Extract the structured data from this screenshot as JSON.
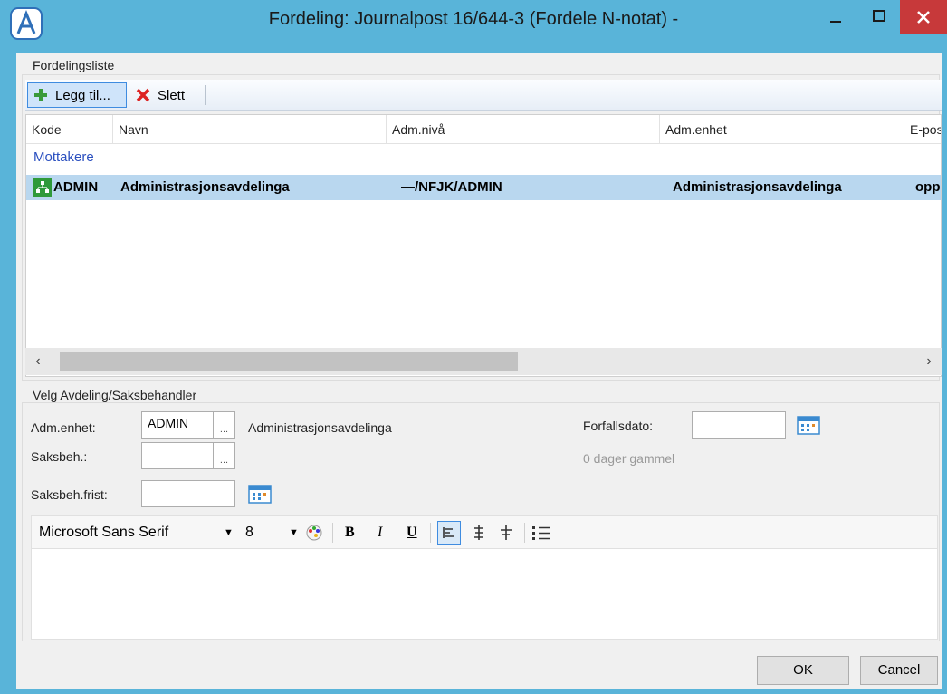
{
  "window": {
    "title": "Fordeling: Journalpost 16/644-3 (Fordele N-notat) -",
    "icon": "a-logo-icon",
    "controls": [
      "minimize-icon",
      "maximize-icon",
      "close-icon"
    ],
    "colors": {
      "titlebar": "#59b4d9",
      "close": "#c7393a",
      "selection": "#b9d7ef",
      "group_link": "#2a4fbf"
    }
  },
  "distribution": {
    "group_title": "Fordelingsliste",
    "toolbar": {
      "add_label": "Legg til...",
      "delete_label": "Slett"
    },
    "columns": [
      "Kode",
      "Navn",
      "Adm.nivå",
      "Adm.enhet",
      "E-pos"
    ],
    "group_label": "Mottakere",
    "rows": [
      {
        "code": "ADMIN",
        "name": "Administrasjonsavdelinga",
        "level": "—/NFJK/ADMIN",
        "unit": "Administrasjonsavdelinga",
        "email": "opp"
      }
    ]
  },
  "selector": {
    "group_title": "Velg Avdeling/Saksbehandler",
    "adm_unit_label": "Adm.enhet:",
    "adm_unit_value": "ADMIN",
    "adm_unit_name": "Administrasjonsavdelinga",
    "case_handler_label": "Saksbeh.:",
    "case_handler_value": "",
    "due_date_label": "Forfallsdato:",
    "due_date_value": "",
    "age_text": "0 dager gammel",
    "handler_deadline_label": "Saksbeh.frist:",
    "handler_deadline_value": "",
    "browse_label": "..."
  },
  "editor": {
    "font_name": "Microsoft Sans Serif",
    "font_size": "8",
    "bold": "B",
    "italic": "I",
    "underline": "U"
  },
  "buttons": {
    "ok": "OK",
    "cancel": "Cancel"
  }
}
